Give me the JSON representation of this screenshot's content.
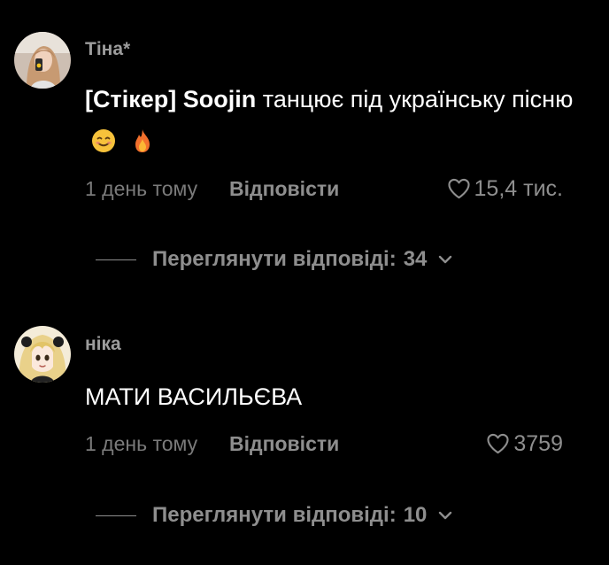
{
  "comments": [
    {
      "username": "Тіна*",
      "sticker_label": "[Стікер]",
      "mention": "Soojin",
      "text_after_mention": "танцює під українську пісню",
      "emojis": [
        "smiling-face-icon",
        "fire-icon"
      ],
      "timestamp": "1 день тому",
      "reply_label": "Відповісти",
      "likes": "15,4 тис.",
      "view_replies_label": "Переглянути відповіді:",
      "view_replies_count": "34"
    },
    {
      "username": "ніка",
      "text": "МАТИ ВАСИЛЬЄВА",
      "timestamp": "1 день тому",
      "reply_label": "Відповісти",
      "likes": "3759",
      "view_replies_label": "Переглянути відповіді:",
      "view_replies_count": "10"
    }
  ],
  "colors": {
    "background": "#000000",
    "primary_text": "#ffffff",
    "secondary_text": "#8e8e8e"
  }
}
